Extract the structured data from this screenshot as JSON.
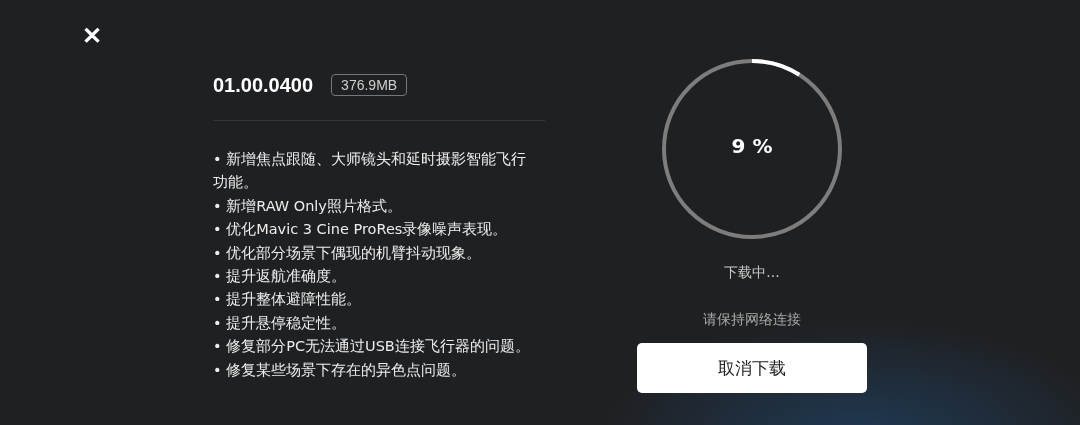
{
  "close_button": {
    "label": "✕"
  },
  "version": "01.00.0400",
  "size_badge": "376.9MB",
  "release_notes": [
    "• 新增焦点跟随、大师镜头和延时摄影智能飞行功能。",
    "• 新增RAW Only照片格式。",
    "• 优化Mavic 3 Cine ProRes录像噪声表现。",
    "• 优化部分场景下偶现的机臂抖动现象。",
    "• 提升返航准确度。",
    "• 提升整体避障性能。",
    "• 提升悬停稳定性。",
    "• 修复部分PC无法通过USB连接飞行器的问题。",
    "• 修复某些场景下存在的异色点问题。"
  ],
  "progress": {
    "reading": "9 %",
    "status": "下载中...",
    "hint": "请保持网络连接"
  },
  "cancel_button": {
    "label": "取消下载"
  }
}
